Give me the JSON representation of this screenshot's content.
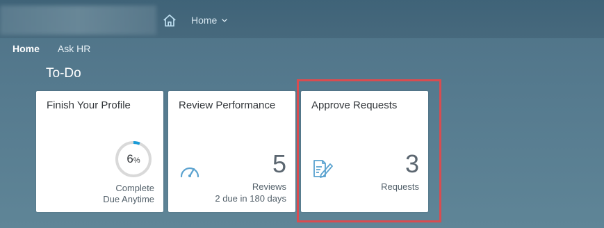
{
  "header": {
    "home_menu_label": "Home",
    "home_icon": "home-icon",
    "chevron_icon": "chevron-down-icon"
  },
  "nav": {
    "items": [
      {
        "label": "Home",
        "active": true
      },
      {
        "label": "Ask HR",
        "active": false
      }
    ]
  },
  "section": {
    "title": "To-Do"
  },
  "tiles": [
    {
      "title": "Finish Your Profile",
      "progress_value": "6",
      "progress_unit": "%",
      "progress_fraction": 0.06,
      "line1": "Complete",
      "line2": "Due Anytime",
      "icon": "progress-ring"
    },
    {
      "title": "Review Performance",
      "count": "5",
      "line1": "Reviews",
      "line2": "2 due in 180 days",
      "icon": "gauge-icon"
    },
    {
      "title": "Approve Requests",
      "count": "3",
      "line1": "Requests",
      "icon": "document-edit-icon"
    }
  ],
  "colors": {
    "accent_blue": "#1a9bd7",
    "highlight_red": "#d94c50",
    "icon_blue": "#5aa2cf"
  }
}
